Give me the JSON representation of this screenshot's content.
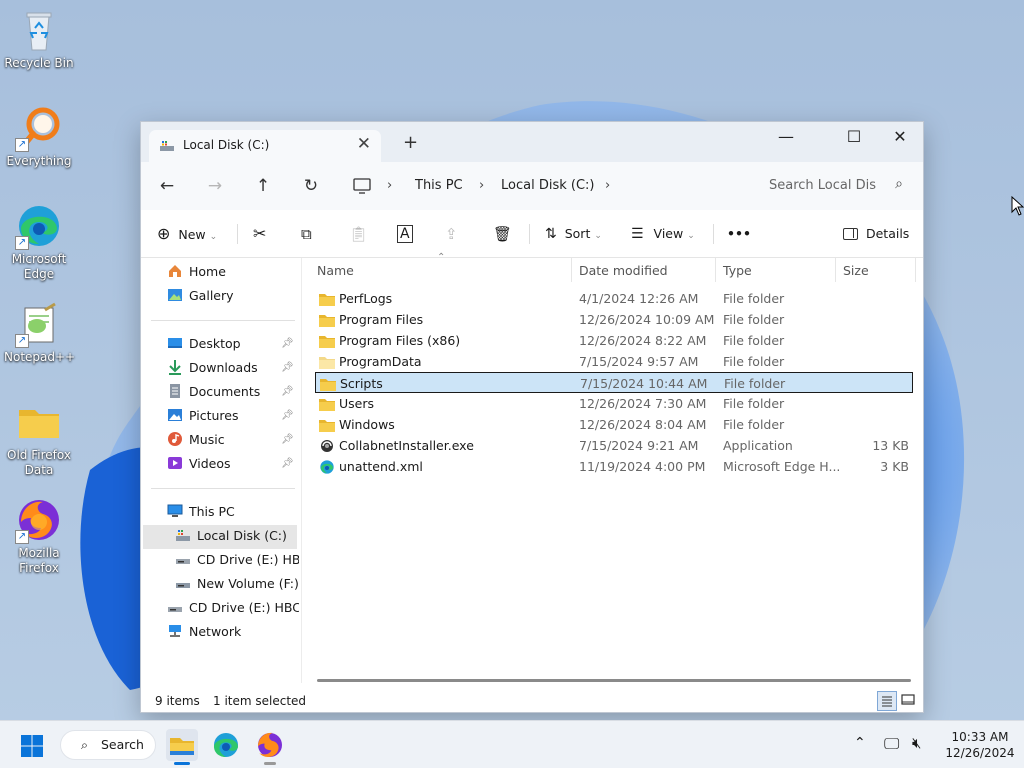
{
  "desktop": {
    "icons": [
      {
        "label": "Recycle Bin",
        "icon": "recycle-bin-icon"
      },
      {
        "label": "Everything",
        "icon": "everything-search-icon"
      },
      {
        "label": "Microsoft Edge",
        "icon": "edge-icon"
      },
      {
        "label": "Notepad++",
        "icon": "notepad-plus-plus-icon"
      },
      {
        "label": "Old Firefox Data",
        "icon": "folder-icon"
      },
      {
        "label": "Mozilla Firefox",
        "icon": "firefox-icon"
      }
    ]
  },
  "window": {
    "tab_title": "Local Disk (C:)",
    "breadcrumb": [
      "This PC",
      "Local Disk (C:)"
    ],
    "search_placeholder": "Search Local Dis",
    "toolbar": {
      "new": "New",
      "sort": "Sort",
      "view": "View",
      "more": "•••",
      "details": "Details"
    },
    "nav": {
      "quick": [
        {
          "label": "Home",
          "icon": "home-icon"
        },
        {
          "label": "Gallery",
          "icon": "gallery-icon"
        }
      ],
      "pinned": [
        {
          "label": "Desktop",
          "icon": "desktop-folder-icon"
        },
        {
          "label": "Downloads",
          "icon": "downloads-icon"
        },
        {
          "label": "Documents",
          "icon": "documents-icon"
        },
        {
          "label": "Pictures",
          "icon": "pictures-icon"
        },
        {
          "label": "Music",
          "icon": "music-icon"
        },
        {
          "label": "Videos",
          "icon": "videos-icon"
        }
      ],
      "tree": [
        {
          "label": "This PC",
          "icon": "this-pc-icon"
        },
        {
          "label": "Local Disk (C:)",
          "icon": "drive-icon"
        },
        {
          "label": "CD Drive (E:) HBCD",
          "icon": "cd-drive-icon"
        },
        {
          "label": "New Volume (F:)",
          "icon": "drive-icon"
        },
        {
          "label": "CD Drive (E:) HBCD_F",
          "icon": "cd-drive-icon"
        },
        {
          "label": "Network",
          "icon": "network-icon"
        }
      ]
    },
    "columns": {
      "name": "Name",
      "date": "Date modified",
      "type": "Type",
      "size": "Size"
    },
    "files": [
      {
        "name": "PerfLogs",
        "date": "4/1/2024 12:26 AM",
        "type": "File folder",
        "size": "",
        "icon": "folder"
      },
      {
        "name": "Program Files",
        "date": "12/26/2024 10:09 AM",
        "type": "File folder",
        "size": "",
        "icon": "folder"
      },
      {
        "name": "Program Files (x86)",
        "date": "12/26/2024 8:22 AM",
        "type": "File folder",
        "size": "",
        "icon": "folder"
      },
      {
        "name": "ProgramData",
        "date": "7/15/2024 9:57 AM",
        "type": "File folder",
        "size": "",
        "icon": "folder-light"
      },
      {
        "name": "Scripts",
        "date": "7/15/2024 10:44 AM",
        "type": "File folder",
        "size": "",
        "icon": "folder"
      },
      {
        "name": "Users",
        "date": "12/26/2024 7:30 AM",
        "type": "File folder",
        "size": "",
        "icon": "folder"
      },
      {
        "name": "Windows",
        "date": "12/26/2024 8:04 AM",
        "type": "File folder",
        "size": "",
        "icon": "folder"
      },
      {
        "name": "CollabnetInstaller.exe",
        "date": "7/15/2024 9:21 AM",
        "type": "Application",
        "size": "13 KB",
        "icon": "exe"
      },
      {
        "name": "unattend.xml",
        "date": "11/19/2024 4:00 PM",
        "type": "Microsoft Edge H...",
        "size": "3 KB",
        "icon": "edge"
      }
    ],
    "selected_index": 4,
    "status": {
      "items": "9 items",
      "selected": "1 item selected"
    }
  },
  "taskbar": {
    "search_label": "Search",
    "time": "10:33 AM",
    "date": "12/26/2024"
  },
  "colors": {
    "accent": "#0067c0",
    "selection": "#cce4f7",
    "folder": "#f3c33f"
  }
}
